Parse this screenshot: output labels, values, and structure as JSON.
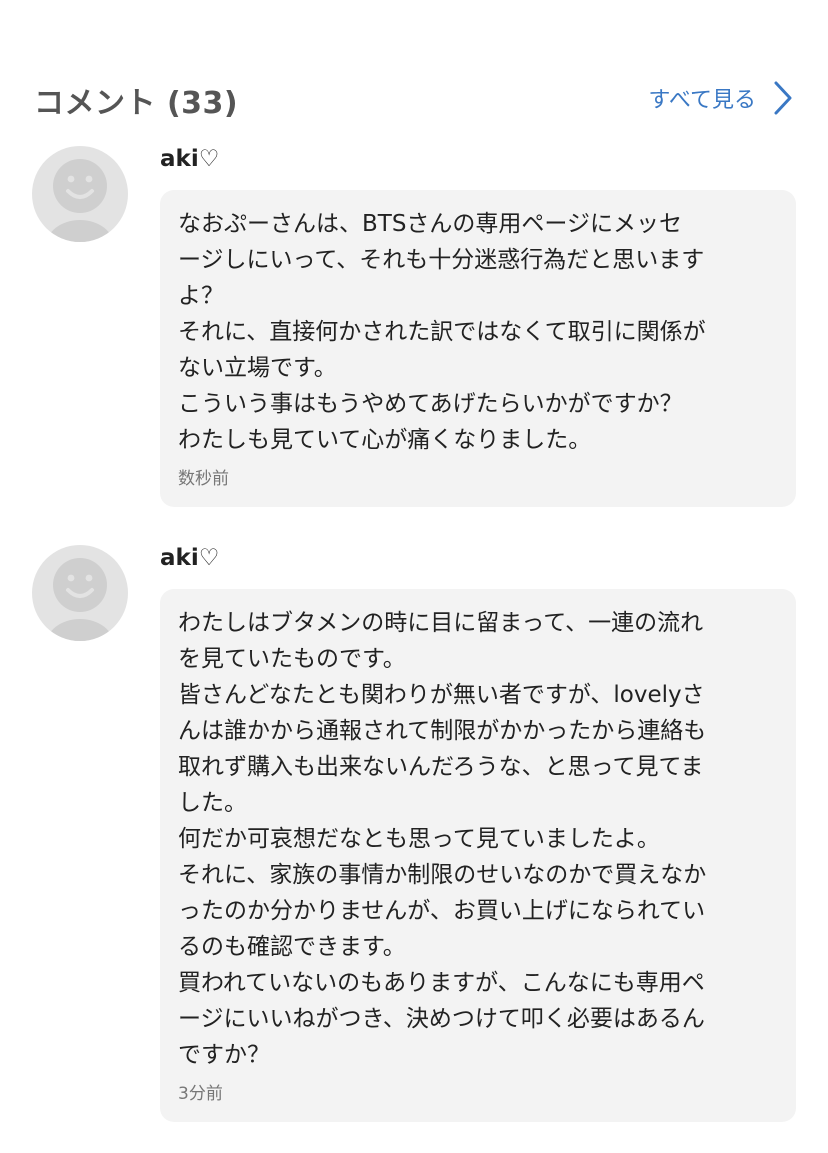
{
  "header": {
    "title": "コメント (33)",
    "see_all_label": "すべて見る",
    "see_all_icon": "chevron-right-icon",
    "accent_color": "#3a78c4"
  },
  "comments": [
    {
      "author": "aki♡",
      "avatar_icon": "default-avatar-icon",
      "lines": [
        "なおぷーさんは、BTSさんの専用ページにメッセ",
        "ージしにいって、それも十分迷惑行為だと思います",
        "よ？",
        "それに、直接何かされた訳ではなくて取引に関係が",
        "ない立場です。",
        "こういう事はもうやめてあげたらいかがですか？",
        "わたしも見ていて心が痛くなりました。"
      ],
      "time": "数秒前"
    },
    {
      "author": "aki♡",
      "avatar_icon": "default-avatar-icon",
      "lines": [
        "わたしはブタメンの時に目に留まって、一連の流れ",
        "を見ていたものです。",
        "皆さんどなたとも関わりが無い者ですが、lovelyさ",
        "んは誰かから通報されて制限がかかったから連絡も",
        "取れず購入も出来ないんだろうな、と思って見てま",
        "した。",
        "何だか可哀想だなとも思って見ていましたよ。",
        "それに、家族の事情か制限のせいなのかで買えなか",
        "ったのか分かりませんが、お買い上げになられてい",
        "るのも確認できます。",
        "買われていないのもありますが、こんなにも専用ペ",
        "ージにいいねがつき、決めつけて叩く必要はあるん",
        "ですか？"
      ],
      "time": "3分前"
    }
  ]
}
